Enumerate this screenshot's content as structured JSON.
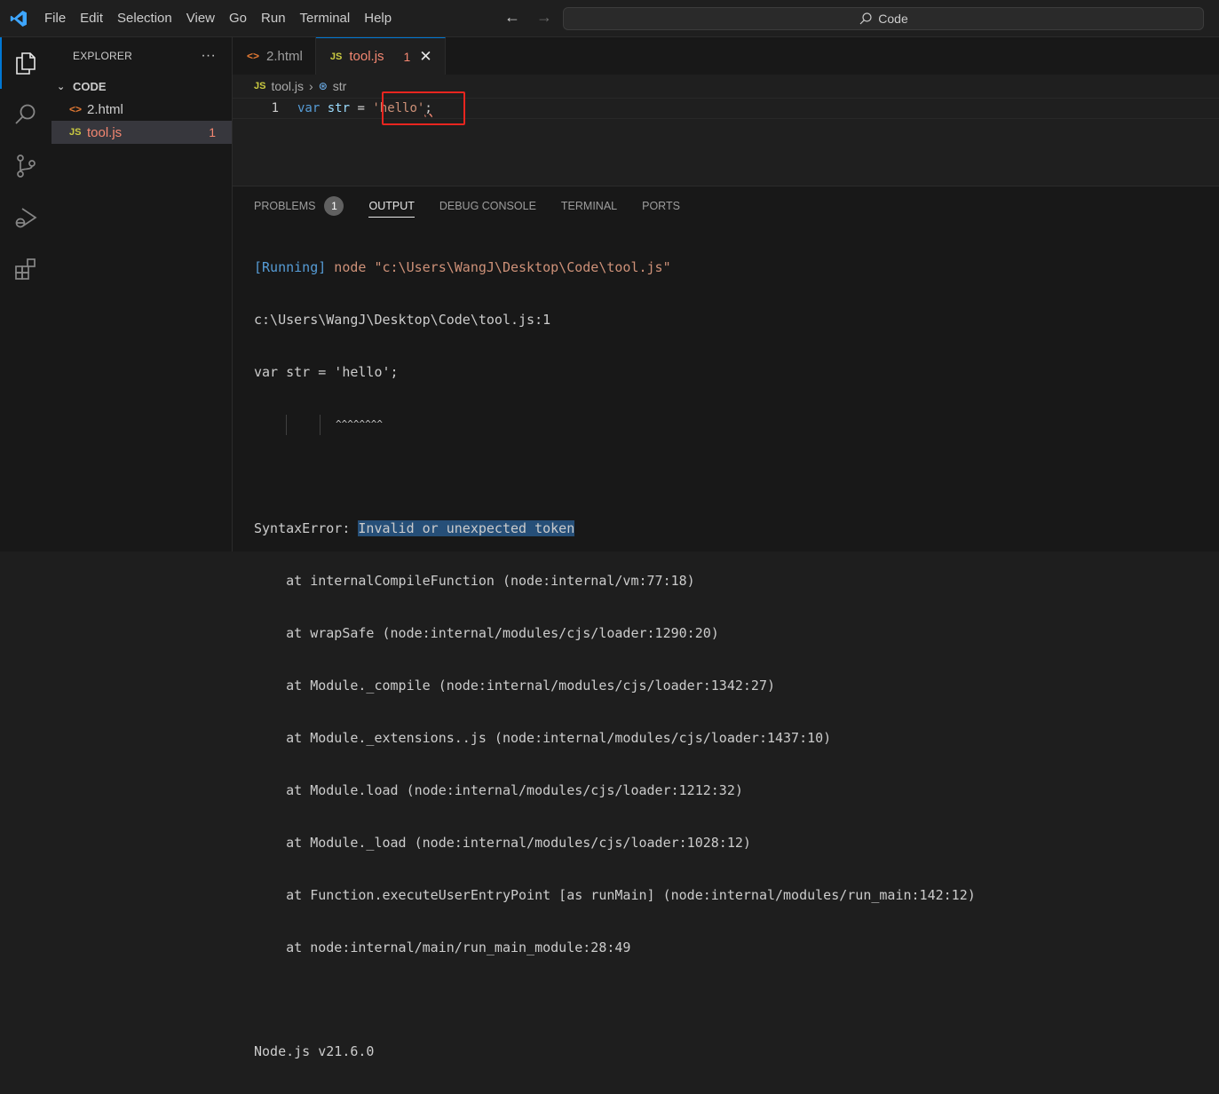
{
  "titlebar": {
    "menu": [
      "File",
      "Edit",
      "Selection",
      "View",
      "Go",
      "Run",
      "Terminal",
      "Help"
    ],
    "search_text": "Code"
  },
  "sidebar": {
    "header": "EXPLORER",
    "more": "···",
    "folder": "CODE",
    "files": [
      {
        "name": "2.html",
        "icon": "<>",
        "badge": ""
      },
      {
        "name": "tool.js",
        "icon": "JS",
        "badge": "1"
      }
    ]
  },
  "editor": {
    "tabs": [
      {
        "name": "2.html",
        "icon": "<>"
      },
      {
        "name": "tool.js",
        "icon": "JS",
        "badge": "1"
      }
    ],
    "breadcrumb": {
      "file": "tool.js",
      "symbol": "str"
    },
    "line_number": "1",
    "code": {
      "kw": "var",
      "id": "str",
      "op": "=",
      "str": "'hello'",
      "semi": ";"
    }
  },
  "panel": {
    "tabs": [
      "PROBLEMS",
      "OUTPUT",
      "DEBUG CONSOLE",
      "TERMINAL",
      "PORTS"
    ],
    "problems_count": "1",
    "output": {
      "running_tag": "[Running]",
      "command": " node \"c:\\Users\\WangJ\\Desktop\\Code\\tool.js\"",
      "location": "c:\\Users\\WangJ\\Desktop\\Code\\tool.js:1",
      "source_line": "var str = 'hello';",
      "carets": "^^^^^^^^",
      "error_prefix": "SyntaxError: ",
      "error_message": "Invalid or unexpected token",
      "stack": [
        "    at internalCompileFunction (node:internal/vm:77:18)",
        "    at wrapSafe (node:internal/modules/cjs/loader:1290:20)",
        "    at Module._compile (node:internal/modules/cjs/loader:1342:27)",
        "    at Module._extensions..js (node:internal/modules/cjs/loader:1437:10)",
        "    at Module.load (node:internal/modules/cjs/loader:1212:32)",
        "    at Module._load (node:internal/modules/cjs/loader:1028:12)",
        "    at Function.executeUserEntryPoint [as runMain] (node:internal/modules/run_main:142:12)",
        "    at node:internal/main/run_main_module:28:49"
      ],
      "version": "Node.js v21.6.0"
    }
  },
  "colors": {
    "accent": "#0078d4",
    "error": "#f48771",
    "highlight_box": "#e8251f"
  }
}
